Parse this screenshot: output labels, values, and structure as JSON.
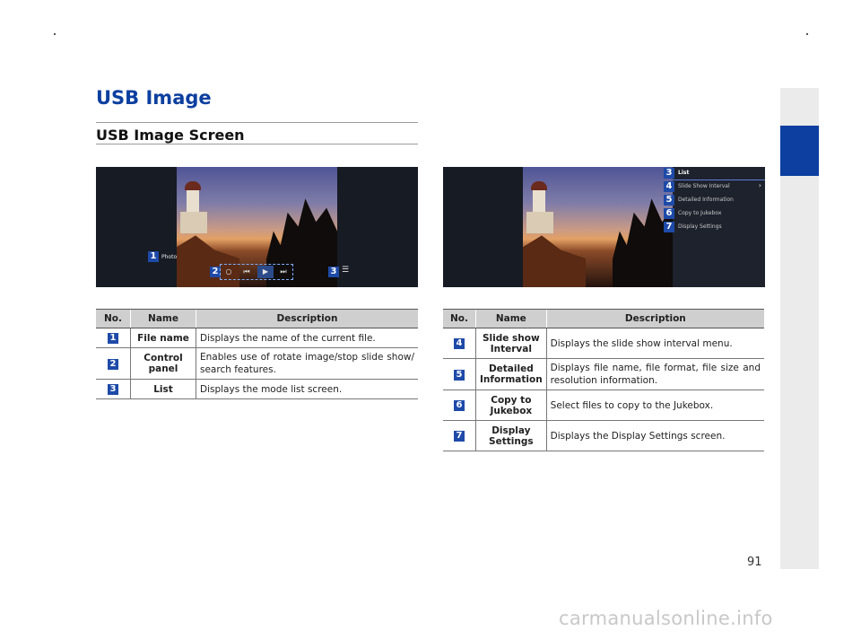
{
  "page": {
    "title": "USB Image",
    "section_title": "USB Image Screen",
    "page_number": "91",
    "watermark": "carmanualsonline.info"
  },
  "screenshot_left": {
    "badges": [
      "1",
      "2",
      "3"
    ],
    "photo_label": "Photo",
    "controls": [
      {
        "icon": "rotate-icon",
        "glyph": "○"
      },
      {
        "icon": "previous-icon",
        "glyph": "⏮"
      },
      {
        "icon": "play-icon",
        "glyph": "▶"
      },
      {
        "icon": "next-icon",
        "glyph": "⏭"
      }
    ],
    "list_glyph": "☰"
  },
  "screenshot_right": {
    "badges": [
      "3",
      "4",
      "5",
      "6",
      "7"
    ],
    "menu": [
      "List",
      "Slide Show Interval",
      "Detailed Information",
      "Copy to Jukebox",
      "Display Settings"
    ],
    "chevron": "›"
  },
  "table_left": {
    "headers": [
      "No.",
      "Name",
      "Description"
    ],
    "rows": [
      {
        "no": "1",
        "name": "File name",
        "desc": "Displays the name of the current file."
      },
      {
        "no": "2",
        "name": "Control panel",
        "desc": "Enables use of rotate image/stop slide show/ search features."
      },
      {
        "no": "3",
        "name": "List",
        "desc": "Displays the mode list screen."
      }
    ]
  },
  "table_right": {
    "headers": [
      "No.",
      "Name",
      "Description"
    ],
    "rows": [
      {
        "no": "4",
        "name": "Slide show Interval",
        "desc": "Displays the slide show interval menu."
      },
      {
        "no": "5",
        "name": "Detailed Information",
        "desc": "Displays file name, file format, file size and resolution information."
      },
      {
        "no": "6",
        "name": "Copy to Jukebox",
        "desc": "Select files to copy to the Jukebox."
      },
      {
        "no": "7",
        "name": "Display Settings",
        "desc": "Displays the Display Settings screen."
      }
    ]
  },
  "colors": {
    "accent": "#0c3f9f",
    "badge": "#1e4aa8",
    "header_bg": "#cfcfcf",
    "sidebar": "#ebebeb"
  }
}
